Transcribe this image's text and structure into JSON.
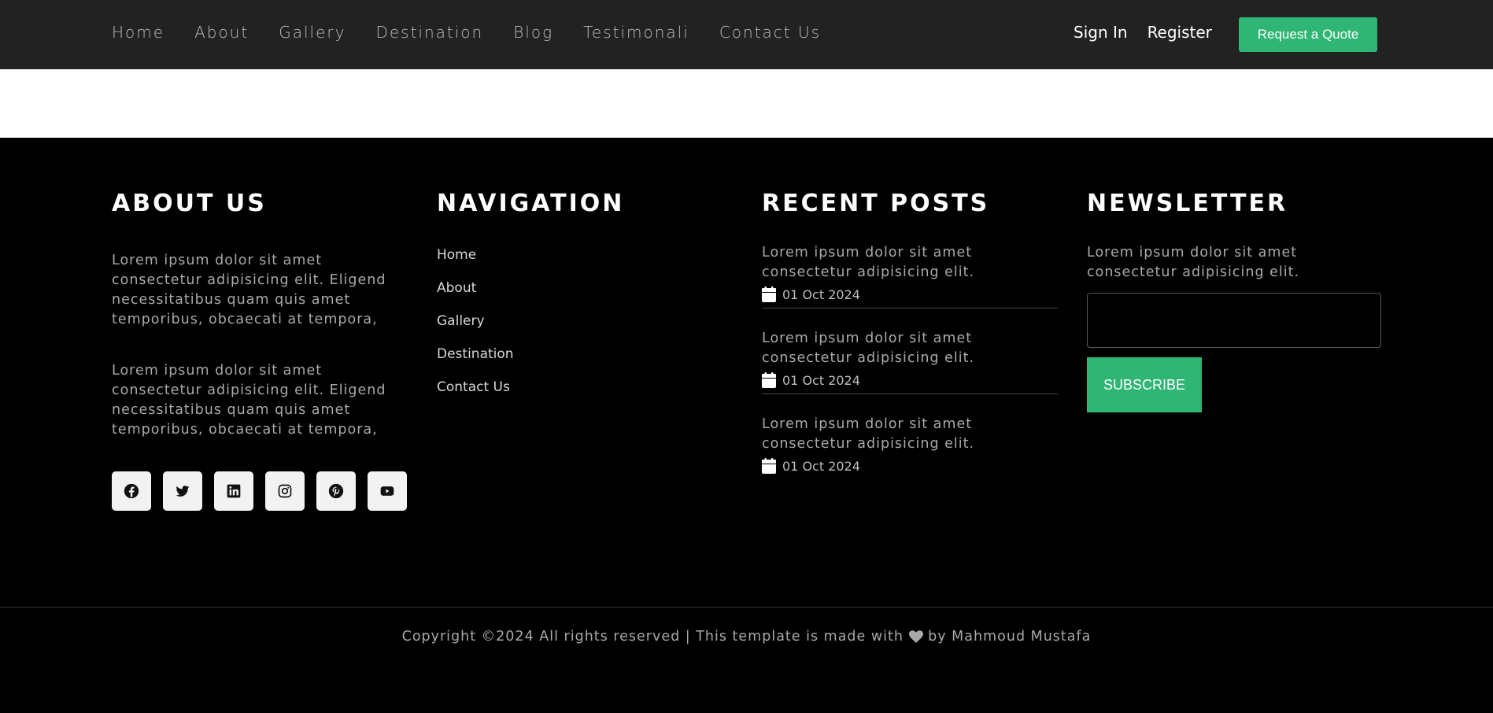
{
  "nav": {
    "links": [
      "Home",
      "About",
      "Gallery",
      "Destination",
      "Blog",
      "Testimonali",
      "Contact Us"
    ],
    "sign_in": "Sign In",
    "register": "Register",
    "quote_button": "Request a Quote"
  },
  "footer": {
    "about": {
      "title": "ABOUT US",
      "paragraphs": [
        "Lorem ipsum dolor sit amet consectetur adipisicing elit. Eligend necessitatibus quam quis amet temporibus, obcaecati at tempora,",
        "Lorem ipsum dolor sit amet consectetur adipisicing elit. Eligend necessitatibus quam quis amet temporibus, obcaecati at tempora,"
      ],
      "socials": [
        "facebook-icon",
        "twitter-icon",
        "linkedin-icon",
        "instagram-icon",
        "pinterest-icon",
        "youtube-icon"
      ]
    },
    "navigation": {
      "title": "NAVIGATION",
      "items": [
        "Home",
        "About",
        "Gallery",
        "Destination",
        "Contact Us"
      ]
    },
    "recent_posts": {
      "title": "RECENT POSTS",
      "posts": [
        {
          "text": "Lorem ipsum dolor sit amet consectetur adipisicing elit.",
          "date": "01 Oct 2024"
        },
        {
          "text": "Lorem ipsum dolor sit amet consectetur adipisicing elit.",
          "date": "01 Oct 2024"
        },
        {
          "text": "Lorem ipsum dolor sit amet consectetur adipisicing elit.",
          "date": "01 Oct 2024"
        }
      ]
    },
    "newsletter": {
      "title": "NEWSLETTER",
      "text": "Lorem ipsum dolor sit amet consectetur adipisicing elit.",
      "input_placeholder": "",
      "button": "SUBSCRIBE"
    },
    "copyright_before": "Copyright ©2024 All rights reserved | This template is made with",
    "copyright_after": "by Mahmoud Mustafa"
  },
  "colors": {
    "accent": "#2fb574",
    "topbar": "#222222",
    "footer": "#000000"
  }
}
